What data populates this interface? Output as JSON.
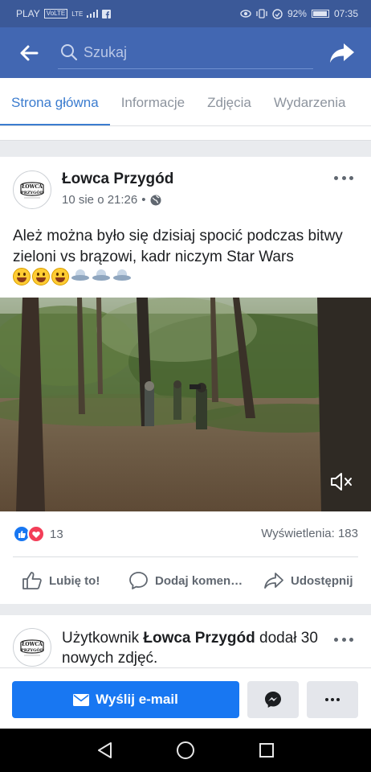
{
  "status_bar": {
    "carrier": "PLAY",
    "network_badge": "VoLTE",
    "signal_label": "LTE",
    "battery": "92%",
    "time": "07:35"
  },
  "appbar": {
    "back_icon": "arrow-left-icon",
    "search_placeholder": "Szukaj",
    "share_icon": "share-arrow-icon"
  },
  "tabs": [
    {
      "label": "Strona główna",
      "active": true
    },
    {
      "label": "Informacje",
      "active": false
    },
    {
      "label": "Zdjęcia",
      "active": false
    },
    {
      "label": "Wydarzenia",
      "active": false
    }
  ],
  "post": {
    "page_name": "Łowca Przygód",
    "avatar_text": "ŁOWCA PRZYGÓD",
    "timestamp": "10 sie o 21:26",
    "separator": "•",
    "privacy_icon": "globe-icon",
    "text": "Ależ można było się dzisiaj spocić podczas bitwy zieloni vs brązowi, kadr niczym Star Wars",
    "emojis": [
      "grinning-face",
      "grinning-face",
      "grinning-face",
      "ufo",
      "ufo",
      "ufo"
    ],
    "reaction_count": "13",
    "views": "Wyświetlenia: 183",
    "actions": {
      "like": "Lubię to!",
      "comment": "Dodaj komen…",
      "share": "Udostępnij"
    }
  },
  "post2": {
    "prefix": "Użytkownik ",
    "page_name": "Łowca Przygód",
    "suffix": " dodał 30 nowych zdjęć."
  },
  "bottom_bar": {
    "email_label": "Wyślij e-mail",
    "messenger_icon": "messenger-icon",
    "more_icon": "more-icon"
  },
  "colors": {
    "brand": "#4267b2",
    "status": "#3b5998",
    "accent": "#1877f2",
    "tab_active": "#3b7ccf"
  }
}
